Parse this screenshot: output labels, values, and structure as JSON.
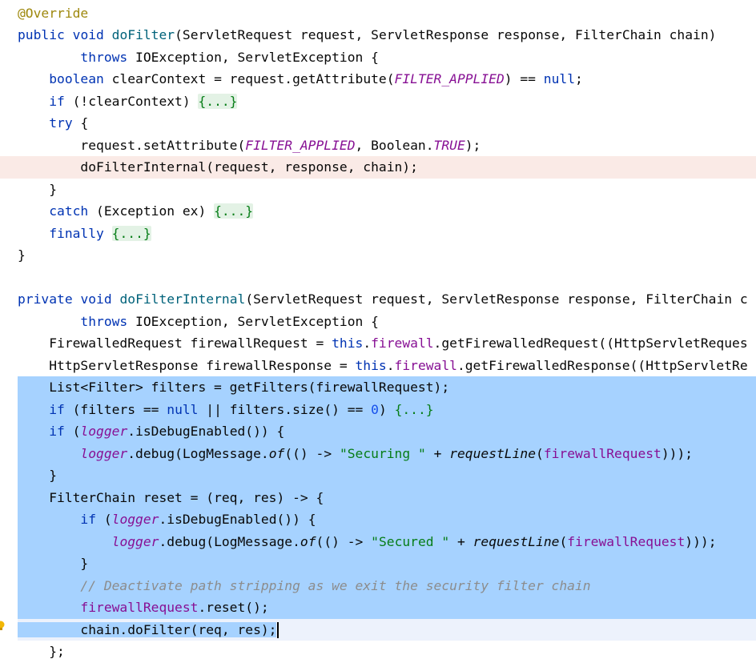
{
  "editor": {
    "lines": [
      {
        "id": "l1",
        "bg": "",
        "segs": [
          {
            "c": "ann",
            "t": "@Override"
          }
        ]
      },
      {
        "id": "l2",
        "bg": "",
        "segs": [
          {
            "c": "kw",
            "t": "public"
          },
          {
            "c": "",
            "t": " "
          },
          {
            "c": "kw",
            "t": "void"
          },
          {
            "c": "",
            "t": " "
          },
          {
            "c": "fn",
            "t": "doFilter"
          },
          {
            "c": "",
            "t": "(ServletRequest request, ServletResponse response, FilterChain chain)"
          }
        ]
      },
      {
        "id": "l3",
        "bg": "",
        "segs": [
          {
            "c": "",
            "t": "        "
          },
          {
            "c": "kw",
            "t": "throws"
          },
          {
            "c": "",
            "t": " IOException, ServletException {"
          }
        ]
      },
      {
        "id": "l4",
        "bg": "",
        "segs": [
          {
            "c": "",
            "t": "    "
          },
          {
            "c": "kw",
            "t": "boolean"
          },
          {
            "c": "",
            "t": " clearContext = request.getAttribute("
          },
          {
            "c": "cst",
            "t": "FILTER_APPLIED"
          },
          {
            "c": "",
            "t": ") == "
          },
          {
            "c": "kw",
            "t": "null"
          },
          {
            "c": "",
            "t": ";"
          }
        ]
      },
      {
        "id": "l5",
        "bg": "",
        "segs": [
          {
            "c": "",
            "t": "    "
          },
          {
            "c": "kw",
            "t": "if"
          },
          {
            "c": "",
            "t": " (!clearContext) "
          },
          {
            "c": "fold",
            "t": "{...}"
          }
        ]
      },
      {
        "id": "l6",
        "bg": "",
        "segs": [
          {
            "c": "",
            "t": "    "
          },
          {
            "c": "kw",
            "t": "try"
          },
          {
            "c": "",
            "t": " {"
          }
        ]
      },
      {
        "id": "l7",
        "bg": "",
        "segs": [
          {
            "c": "",
            "t": "        request.setAttribute("
          },
          {
            "c": "cst",
            "t": "FILTER_APPLIED"
          },
          {
            "c": "",
            "t": ", Boolean."
          },
          {
            "c": "cst",
            "t": "TRUE"
          },
          {
            "c": "",
            "t": ");"
          }
        ]
      },
      {
        "id": "l8",
        "bg": "err",
        "segs": [
          {
            "c": "",
            "t": "        doFilterInternal(request, response, chain);"
          }
        ]
      },
      {
        "id": "l9",
        "bg": "",
        "segs": [
          {
            "c": "",
            "t": "    }"
          }
        ]
      },
      {
        "id": "l10",
        "bg": "",
        "segs": [
          {
            "c": "",
            "t": "    "
          },
          {
            "c": "kw",
            "t": "catch"
          },
          {
            "c": "",
            "t": " (Exception ex) "
          },
          {
            "c": "fold",
            "t": "{...}"
          }
        ]
      },
      {
        "id": "l11",
        "bg": "",
        "segs": [
          {
            "c": "",
            "t": "    "
          },
          {
            "c": "kw",
            "t": "finally"
          },
          {
            "c": "",
            "t": " "
          },
          {
            "c": "fold",
            "t": "{...}"
          }
        ]
      },
      {
        "id": "l12",
        "bg": "",
        "segs": [
          {
            "c": "",
            "t": "}"
          }
        ]
      },
      {
        "id": "l13",
        "bg": "",
        "segs": [
          {
            "c": "",
            "t": ""
          }
        ]
      },
      {
        "id": "l14",
        "bg": "",
        "segs": [
          {
            "c": "kw",
            "t": "private"
          },
          {
            "c": "",
            "t": " "
          },
          {
            "c": "kw",
            "t": "void"
          },
          {
            "c": "",
            "t": " "
          },
          {
            "c": "fn",
            "t": "doFilterInternal"
          },
          {
            "c": "",
            "t": "(ServletRequest request, ServletResponse response, FilterChain c"
          }
        ]
      },
      {
        "id": "l15",
        "bg": "",
        "segs": [
          {
            "c": "",
            "t": "        "
          },
          {
            "c": "kw",
            "t": "throws"
          },
          {
            "c": "",
            "t": " IOException, ServletException {"
          }
        ]
      },
      {
        "id": "l16",
        "bg": "",
        "segs": [
          {
            "c": "",
            "t": "    FirewalledRequest firewallRequest = "
          },
          {
            "c": "kw",
            "t": "this"
          },
          {
            "c": "",
            "t": "."
          },
          {
            "c": "fld",
            "t": "firewall"
          },
          {
            "c": "",
            "t": ".getFirewalledRequest((HttpServletReques"
          }
        ]
      },
      {
        "id": "l17",
        "bg": "",
        "segs": [
          {
            "c": "",
            "t": "    HttpServletResponse firewallResponse = "
          },
          {
            "c": "kw",
            "t": "this"
          },
          {
            "c": "",
            "t": "."
          },
          {
            "c": "fld",
            "t": "firewall"
          },
          {
            "c": "",
            "t": ".getFirewalledResponse((HttpServletRe"
          }
        ]
      },
      {
        "id": "l18",
        "bg": "sel",
        "segs": [
          {
            "c": "",
            "t": "    List<Filter> filters = getFilters(firewallRequest);"
          }
        ]
      },
      {
        "id": "l19",
        "bg": "sel",
        "segs": [
          {
            "c": "",
            "t": "    "
          },
          {
            "c": "kw",
            "t": "if"
          },
          {
            "c": "",
            "t": " (filters == "
          },
          {
            "c": "kw",
            "t": "null"
          },
          {
            "c": "",
            "t": " || filters.size() == "
          },
          {
            "c": "num",
            "t": "0"
          },
          {
            "c": "",
            "t": ") "
          },
          {
            "c": "str",
            "t": "{...}"
          }
        ]
      },
      {
        "id": "l20",
        "bg": "sel",
        "segs": [
          {
            "c": "",
            "t": "    "
          },
          {
            "c": "kw",
            "t": "if"
          },
          {
            "c": "",
            "t": " ("
          },
          {
            "c": "cst",
            "t": "logger"
          },
          {
            "c": "",
            "t": ".isDebugEnabled()) {"
          }
        ]
      },
      {
        "id": "l21",
        "bg": "sel",
        "segs": [
          {
            "c": "",
            "t": "        "
          },
          {
            "c": "cst",
            "t": "logger"
          },
          {
            "c": "",
            "t": ".debug(LogMessage."
          },
          {
            "c": "st",
            "t": "of"
          },
          {
            "c": "",
            "t": "(() -> "
          },
          {
            "c": "str",
            "t": "\"Securing \""
          },
          {
            "c": "",
            "t": " + "
          },
          {
            "c": "st",
            "t": "requestLine"
          },
          {
            "c": "",
            "t": "("
          },
          {
            "c": "fld",
            "t": "firewallRequest"
          },
          {
            "c": "",
            "t": ")));"
          }
        ]
      },
      {
        "id": "l22",
        "bg": "sel",
        "segs": [
          {
            "c": "",
            "t": "    }"
          }
        ]
      },
      {
        "id": "l23",
        "bg": "sel",
        "segs": [
          {
            "c": "",
            "t": "    FilterChain reset = (req, res) -> {"
          }
        ]
      },
      {
        "id": "l24",
        "bg": "sel",
        "segs": [
          {
            "c": "",
            "t": "        "
          },
          {
            "c": "kw",
            "t": "if"
          },
          {
            "c": "",
            "t": " ("
          },
          {
            "c": "cst",
            "t": "logger"
          },
          {
            "c": "",
            "t": ".isDebugEnabled()) {"
          }
        ]
      },
      {
        "id": "l25",
        "bg": "sel",
        "segs": [
          {
            "c": "",
            "t": "            "
          },
          {
            "c": "cst",
            "t": "logger"
          },
          {
            "c": "",
            "t": ".debug(LogMessage."
          },
          {
            "c": "st",
            "t": "of"
          },
          {
            "c": "",
            "t": "(() -> "
          },
          {
            "c": "str",
            "t": "\"Secured \""
          },
          {
            "c": "",
            "t": " + "
          },
          {
            "c": "st",
            "t": "requestLine"
          },
          {
            "c": "",
            "t": "("
          },
          {
            "c": "fld",
            "t": "firewallRequest"
          },
          {
            "c": "",
            "t": ")));"
          }
        ]
      },
      {
        "id": "l26",
        "bg": "sel",
        "segs": [
          {
            "c": "",
            "t": "        }"
          }
        ]
      },
      {
        "id": "l27",
        "bg": "sel",
        "segs": [
          {
            "c": "",
            "t": "        "
          },
          {
            "c": "cmt",
            "t": "// Deactivate path stripping as we exit the security filter chain"
          }
        ]
      },
      {
        "id": "l28",
        "bg": "sel",
        "segs": [
          {
            "c": "",
            "t": "        "
          },
          {
            "c": "fld",
            "t": "firewallRequest"
          },
          {
            "c": "",
            "t": ".reset();"
          }
        ]
      },
      {
        "id": "l29",
        "bg": "caret",
        "segs": [
          {
            "c": "selpart",
            "t": "        chain.doFilter(req, res);"
          }
        ]
      },
      {
        "id": "l30",
        "bg": "",
        "segs": [
          {
            "c": "",
            "t": "    };"
          }
        ]
      }
    ]
  }
}
